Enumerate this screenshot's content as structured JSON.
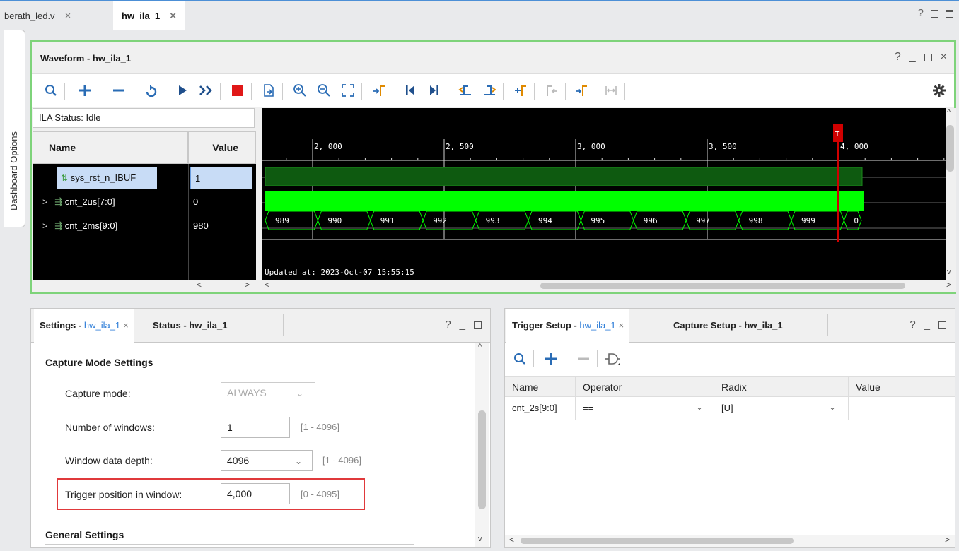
{
  "file_tabs": [
    {
      "label": "berath_led.v",
      "close": "×"
    },
    {
      "label": "hw_ila_1",
      "close": "×"
    }
  ],
  "tabbar_icons": {
    "help": "?"
  },
  "dashboard_tab": "Dashboard Options",
  "waveform": {
    "title": "Waveform - hw_ila_1",
    "window_icons": {
      "help": "?",
      "minimize": "_",
      "close": "×"
    },
    "ila_status": "ILA Status: Idle",
    "col_name": "Name",
    "col_value": "Value",
    "signals": [
      {
        "name": "sys_rst_n_IBUF",
        "value": "1",
        "expander": ""
      },
      {
        "name": "cnt_2us[7:0]",
        "value": "0",
        "expander": ">"
      },
      {
        "name": "cnt_2ms[9:0]",
        "value": "980",
        "expander": ">"
      }
    ],
    "time_ticks": [
      "2, 000",
      "2, 500",
      "3, 000",
      "3, 500",
      "4, 000"
    ],
    "bus_values": [
      "989",
      "990",
      "991",
      "992",
      "993",
      "994",
      "995",
      "996",
      "997",
      "998",
      "999",
      "0"
    ],
    "trigger_marker": "T",
    "updated_at": "Updated at: 2023-Oct-07 15:55:15",
    "colors": {
      "wave_green": "#00ff00",
      "dark_green": "#0e5a10",
      "cursor_red": "#d00000",
      "bg": "#000000"
    }
  },
  "settings_panel": {
    "tab1_prefix": "Settings - ",
    "tab1_link": "hw_ila_1",
    "tab1_close": "×",
    "tab2": "Status - hw_ila_1",
    "icons": {
      "help": "?",
      "minimize": "_"
    },
    "capture_section": "Capture Mode Settings",
    "capture_mode_label": "Capture mode:",
    "capture_mode_value": "ALWAYS",
    "num_windows_label": "Number of windows:",
    "num_windows_value": "1",
    "num_windows_range": "[1 - 4096]",
    "depth_label": "Window data depth:",
    "depth_value": "4096",
    "depth_range": "[1 - 4096]",
    "trigger_pos_label": "Trigger position in window:",
    "trigger_pos_value": "4,000",
    "trigger_pos_range": "[0 - 4095]",
    "general_section": "General Settings"
  },
  "trigger_panel": {
    "tab1_prefix": "Trigger Setup - ",
    "tab1_link": "hw_ila_1",
    "tab1_close": "×",
    "tab2": "Capture Setup - hw_ila_1",
    "icons": {
      "help": "?",
      "minimize": "_"
    },
    "columns": [
      "Name",
      "Operator",
      "Radix",
      "Value"
    ],
    "rows": [
      {
        "name": "cnt_2s[9:0]",
        "operator": "==",
        "radix": "[U]",
        "value": ""
      }
    ]
  }
}
